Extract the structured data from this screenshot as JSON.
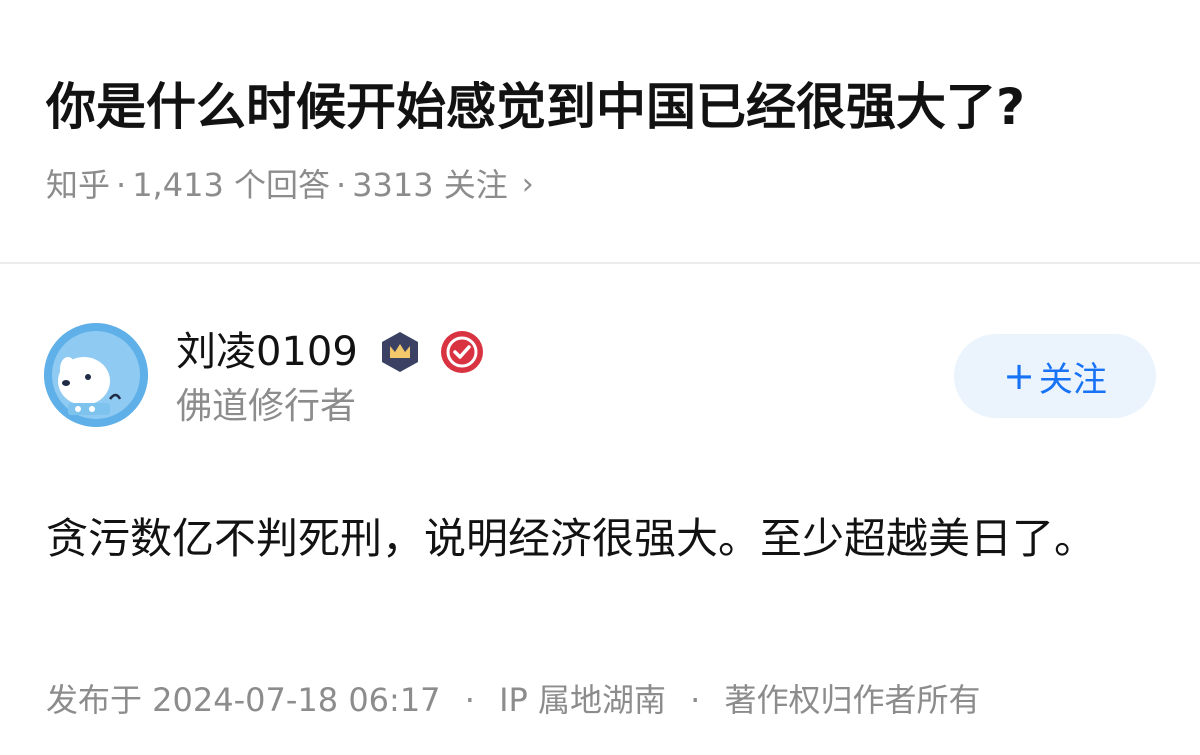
{
  "question": {
    "title": "你是什么时候开始感觉到中国已经很强大了?",
    "meta": {
      "source": "知乎",
      "answers": "1,413 个回答",
      "followers": "3313 关注",
      "separator": "·",
      "chevron": "›"
    }
  },
  "answer": {
    "author": {
      "name": "刘凌0109",
      "bio": "佛道修行者",
      "badges": [
        "crown-badge-icon",
        "verified-check-icon"
      ]
    },
    "follow_button": {
      "plus": "+",
      "label": "关注"
    },
    "content": "贪污数亿不判死刑，说明经济很强大。至少超越美日了。",
    "footer": {
      "published": "发布于 2024-07-18 06:17",
      "ip": "IP 属地湖南",
      "copyright": "著作权归作者所有",
      "separator": "·"
    }
  },
  "colors": {
    "title": "#121212",
    "meta": "#8c8c8c",
    "accent": "#1772f6",
    "follow_bg": "#ebf4fd",
    "divider": "#ececec",
    "avatar_bg": "#5fb0e8",
    "crown_badge": "#3a4163",
    "verified_badge": "#d93241"
  }
}
